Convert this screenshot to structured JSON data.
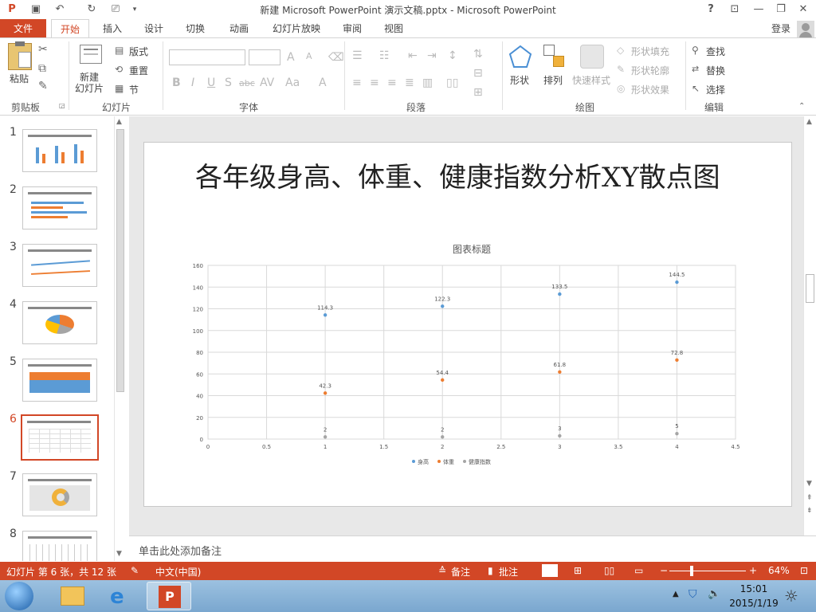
{
  "window": {
    "title": "新建 Microsoft PowerPoint 演示文稿.pptx - Microsoft PowerPoint",
    "help": "?",
    "login": "登录"
  },
  "tabs": [
    "文件",
    "开始",
    "插入",
    "设计",
    "切换",
    "动画",
    "幻灯片放映",
    "审阅",
    "视图"
  ],
  "ribbon": {
    "clipboard": {
      "label": "剪贴板",
      "paste": "粘贴"
    },
    "slides": {
      "label": "幻灯片",
      "new_slide": "新建\n幻灯片",
      "layout": "版式",
      "reset": "重置",
      "section": "节"
    },
    "font": {
      "label": "字体"
    },
    "paragraph": {
      "label": "段落"
    },
    "drawing": {
      "label": "绘图",
      "shapes": "形状",
      "arrange": "排列",
      "quick_styles": "快速样式",
      "fill": "形状填充",
      "outline": "形状轮廓",
      "effects": "形状效果"
    },
    "editing": {
      "label": "编辑",
      "find": "查找",
      "replace": "替换",
      "select": "选择"
    }
  },
  "thumbnails": [
    "1",
    "2",
    "3",
    "4",
    "5",
    "6",
    "7",
    "8"
  ],
  "selected_slide": 6,
  "slide": {
    "title": "各年级身高、体重、健康指数分析XY散点图"
  },
  "chart_data": {
    "type": "scatter",
    "title": "图表标题",
    "xlim": [
      0,
      4.5
    ],
    "ylim": [
      0,
      160
    ],
    "xticks": [
      "0",
      "0.5",
      "1",
      "1.5",
      "2",
      "2.5",
      "3",
      "3.5",
      "4",
      "4.5"
    ],
    "yticks": [
      "0",
      "20",
      "40",
      "60",
      "80",
      "100",
      "120",
      "140",
      "160"
    ],
    "grid": true,
    "legend_position": "bottom",
    "x": [
      1,
      2,
      3,
      4
    ],
    "series": [
      {
        "name": "身高",
        "values": [
          114.3,
          122.3,
          133.5,
          144.5
        ],
        "labels": [
          "114.3",
          "122.3",
          "133.5",
          "144.5"
        ],
        "color": "#5b9bd5"
      },
      {
        "name": "体重",
        "values": [
          42.3,
          54.4,
          61.8,
          72.8
        ],
        "labels": [
          "42.3",
          "54.4",
          "61.8",
          "72.8"
        ],
        "color": "#ed7d31"
      },
      {
        "name": "健康指数",
        "values": [
          2,
          2,
          3,
          5
        ],
        "labels": [
          "2",
          "2",
          "3",
          "5"
        ],
        "color": "#a5a5a5"
      }
    ]
  },
  "notes": {
    "placeholder": "单击此处添加备注"
  },
  "status": {
    "slide_info": "幻灯片 第 6 张，共 12 张",
    "language": "中文(中国)",
    "notes": "备注",
    "comments": "批注",
    "zoom": "64%"
  },
  "taskbar": {
    "time": "15:01",
    "date": "2015/1/19"
  },
  "colors": {
    "accent": "#d24726"
  }
}
